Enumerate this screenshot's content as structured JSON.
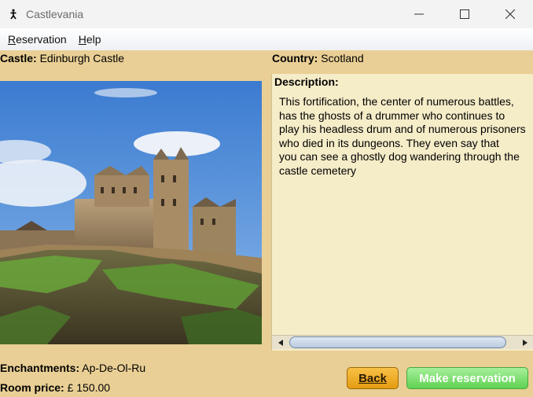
{
  "window": {
    "title": "Castlevania"
  },
  "menu": {
    "items": [
      {
        "label": "Reservation"
      },
      {
        "label": "Help"
      }
    ]
  },
  "castle": {
    "label": "Castle:",
    "value": "Edinburgh Castle"
  },
  "country": {
    "label": "Country:",
    "value": "Scotland"
  },
  "description": {
    "label": "Description:",
    "lines": [
      "This fortification, the center of numerous battles,",
      "has the ghosts of a drummer who continues to",
      "play his headless drum and of numerous prisoners",
      "who died in its dungeons. They even say that",
      "you can see a ghostly dog wandering through the",
      "castle cemetery"
    ]
  },
  "enchantments": {
    "label": "Enchantments:",
    "value": "Ap-De-Ol-Ru"
  },
  "room_price": {
    "label": "Room price:",
    "value": "£ 150.00"
  },
  "buttons": {
    "back": "Back",
    "make_reservation": "Make reservation"
  },
  "colors": {
    "background": "#e9cf95",
    "description_bg": "#f5ecc8",
    "back_button": "#eaa41f",
    "reserve_button": "#7fdf72"
  }
}
